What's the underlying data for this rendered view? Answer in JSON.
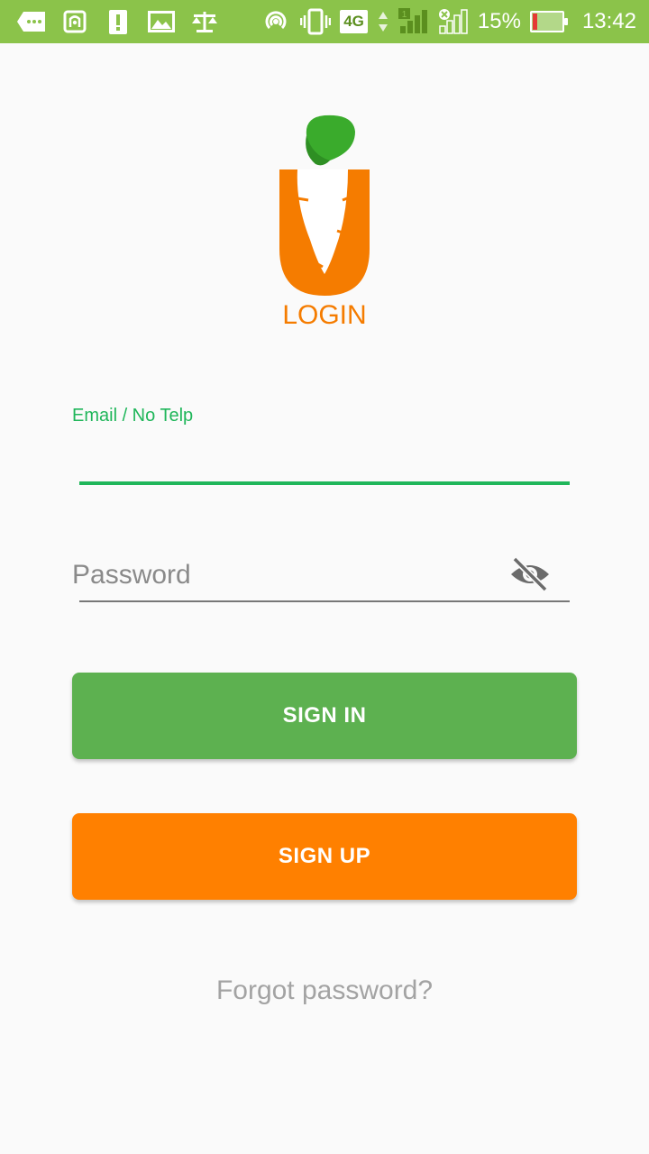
{
  "status_bar": {
    "left_icons": [
      "chat-bubble-icon",
      "nfc-icon",
      "alert-icon",
      "image-icon",
      "scale-icon"
    ],
    "network_badge": "4G",
    "sim_slot": "1",
    "battery_percent": "15%",
    "battery_level": 0.15,
    "time": "13:42",
    "background_color": "#8bc34a"
  },
  "logo": {
    "title": "LOGIN",
    "title_color": "#f57c00",
    "leaf_color": "#3aab2c",
    "u_color": "#f57c00"
  },
  "form": {
    "email_label": "Email / No Telp",
    "email_value": "",
    "password_placeholder": "Password",
    "password_value": "",
    "accent_color": "#1fb65a"
  },
  "buttons": {
    "sign_in": "SIGN IN",
    "sign_up": "SIGN UP",
    "sign_in_color": "#5db150",
    "sign_up_color": "#ff8000"
  },
  "links": {
    "forgot_password": "Forgot password?"
  }
}
